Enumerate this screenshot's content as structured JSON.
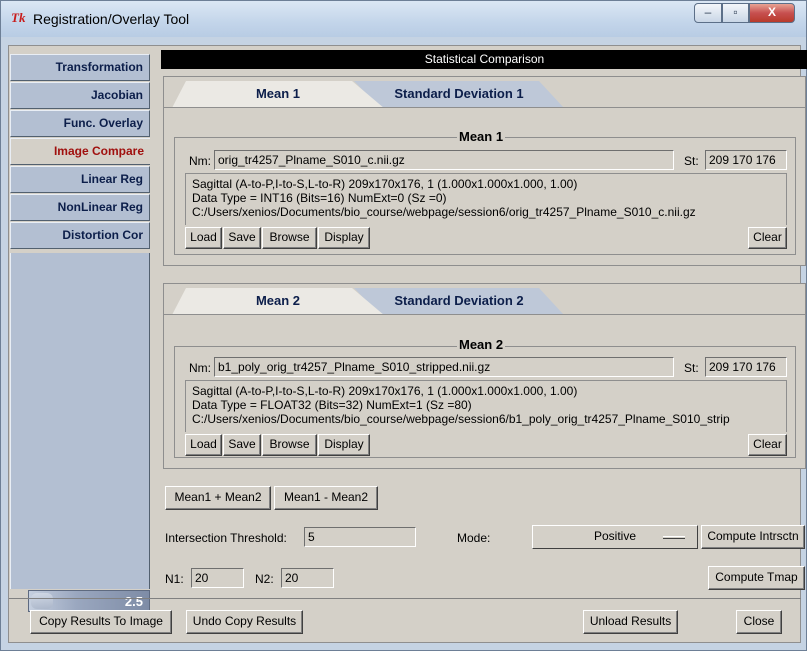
{
  "window": {
    "title": "Registration/Overlay Tool",
    "app_icon": "Tk",
    "controls": {
      "minimize": "–",
      "maximize": "▫",
      "close": "X"
    }
  },
  "nav": {
    "items": [
      {
        "label": "Transformation",
        "active": false
      },
      {
        "label": "Jacobian",
        "active": false
      },
      {
        "label": "Func. Overlay",
        "active": false
      },
      {
        "label": "Image Compare",
        "active": true
      },
      {
        "label": "Linear Reg",
        "active": false
      },
      {
        "label": "NonLinear Reg",
        "active": false
      },
      {
        "label": "Distortion Cor",
        "active": false
      }
    ],
    "slider_value": "2.5"
  },
  "header": {
    "title": "Statistical Comparison"
  },
  "section1": {
    "tabs": [
      "Mean 1",
      "Standard Deviation 1"
    ],
    "group_title": "Mean 1",
    "name_label": "Nm:",
    "name_value": "orig_tr4257_Plname_S010_c.nii.gz",
    "st_label": "St:",
    "st_value": "209 170 176",
    "info": [
      "Sagittal (A-to-P,I-to-S,L-to-R) 209x170x176, 1  (1.000x1.000x1.000, 1.00)",
      "Data Type = INT16 (Bits=16) NumExt=0 (Sz =0)",
      "C:/Users/xenios/Documents/bio_course/webpage/session6/orig_tr4257_Plname_S010_c.nii.gz"
    ],
    "buttons": {
      "load": "Load",
      "save": "Save",
      "browse": "Browse",
      "display": "Display",
      "clear": "Clear"
    }
  },
  "section2": {
    "tabs": [
      "Mean 2",
      "Standard Deviation 2"
    ],
    "group_title": "Mean 2",
    "name_label": "Nm:",
    "name_value": "b1_poly_orig_tr4257_Plname_S010_stripped.nii.gz",
    "st_label": "St:",
    "st_value": "209 170 176",
    "info": [
      "Sagittal (A-to-P,I-to-S,L-to-R) 209x170x176, 1  (1.000x1.000x1.000, 1.00)",
      "Data Type = FLOAT32 (Bits=32) NumExt=1 (Sz =80)",
      "C:/Users/xenios/Documents/bio_course/webpage/session6/b1_poly_orig_tr4257_Plname_S010_strip"
    ],
    "buttons": {
      "load": "Load",
      "save": "Save",
      "browse": "Browse",
      "display": "Display",
      "clear": "Clear"
    }
  },
  "ops": {
    "sum": "Mean1 + Mean2",
    "diff": "Mean1 - Mean2",
    "threshold_label": "Intersection Threshold:",
    "threshold_value": "5",
    "mode_label": "Mode:",
    "mode_value": "Positive",
    "compute_intersection": "Compute Intrsctn",
    "n1_label": "N1:",
    "n1_value": "20",
    "n2_label": "N2:",
    "n2_value": "20",
    "compute_tmap": "Compute Tmap"
  },
  "footer": {
    "copy_results": "Copy Results To Image",
    "undo_copy": "Undo Copy Results",
    "unload": "Unload Results",
    "close": "Close"
  }
}
